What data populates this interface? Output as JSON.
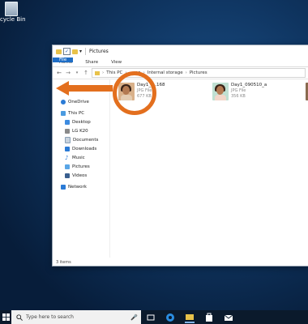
{
  "desktop": {
    "recycle_label": "cycle Bin"
  },
  "window": {
    "title": "Pictures",
    "ribbon_tabs": [
      "File",
      "Home",
      "Share",
      "View"
    ],
    "address_path": [
      "This PC",
      "...me",
      "Internal storage",
      "Pictures"
    ],
    "sidebar": [
      "OneDrive",
      "This PC",
      "Desktop",
      "LG K20",
      "Documents",
      "Downloads",
      "Music",
      "Pictures",
      "Videos",
      "Network"
    ],
    "files": [
      {
        "name": "Day1_I...168",
        "type": "JPG File",
        "size": "677 KB"
      },
      {
        "name": "Day1_090510_a",
        "type": "JPG File",
        "size": "356 KB"
      }
    ],
    "status": "3 items"
  },
  "taskbar": {
    "search_placeholder": "Type here to search"
  },
  "accent": {
    "annotation": "#e36f1e",
    "ribbon_file": "#1f6ec6"
  }
}
